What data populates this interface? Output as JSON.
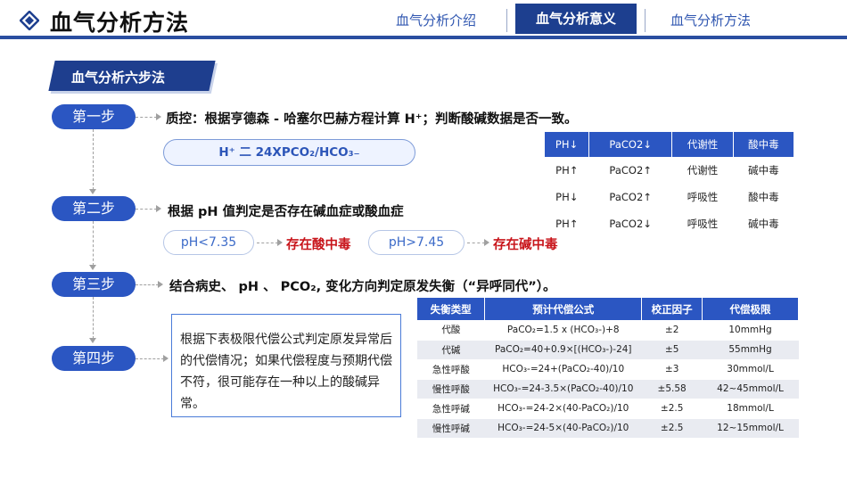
{
  "header": {
    "title": "血气分析方法",
    "nav": [
      "血气分析介绍",
      "血气分析意义",
      "血气分析方法"
    ],
    "active_nav": "血气分析意义"
  },
  "section": {
    "banner": "血气分析六步法"
  },
  "steps": [
    {
      "label": "第一步",
      "text": "质控：根据亨德森 - 哈塞尔巴赫方程计算 H⁺；判断酸碱数据是否一致。"
    },
    {
      "label": "第二步",
      "text": "根据 pH 值判定是否存在碱血症或酸血症"
    },
    {
      "label": "第三步",
      "text": "结合病史、 pH 、 PCO₂, 变化方向判定原发失衡（“异呼同代”）。"
    },
    {
      "label": "第四步",
      "text": ""
    }
  ],
  "formula": "H⁺ 二 24XPCO₂/HCO₃₋",
  "step2": {
    "ph_low": "pH<7.35",
    "ph_low_result": "存在酸中毒",
    "ph_high": "pH>7.45",
    "ph_high_result": "存在碱中毒"
  },
  "note": "根据下表极限代偿公式判定原发异常后的代偿情况；如果代偿程度与预期代偿不符，很可能存在一种以上的酸碱异常。",
  "table1": {
    "headers": [
      "PH↓",
      "PaCO2↓",
      "代谢性",
      "酸中毒"
    ],
    "rows": [
      [
        "PH↑",
        "PaCO2↑",
        "代谢性",
        "碱中毒"
      ],
      [
        "PH↓",
        "PaCO2↑",
        "呼吸性",
        "酸中毒"
      ],
      [
        "PH↑",
        "PaCO2↓",
        "呼吸性",
        "碱中毒"
      ]
    ]
  },
  "table2": {
    "headers": [
      "失衡类型",
      "预计代偿公式",
      "校正因子",
      "代偿极限"
    ],
    "rows": [
      [
        "代酸",
        "PaCO₂=1.5 x (HCO₃-)+8",
        "±2",
        "10mmHg"
      ],
      [
        "代碱",
        "PaCO₂=40+0.9×[(HCO₃-)-24]",
        "±5",
        "55mmHg"
      ],
      [
        "急性呼酸",
        "HCO₃-=24+(PaCO₂-40)/10",
        "±3",
        "30mmol/L"
      ],
      [
        "慢性呼酸",
        "HCO₃-=24-3.5×(PaCO₂-40)/10",
        "±5.58",
        "42~45mmol/L"
      ],
      [
        "急性呼碱",
        "HCO₃-=24-2×(40-PaCO₂)/10",
        "±2.5",
        "18mmol/L"
      ],
      [
        "慢性呼碱",
        "HCO₃-=24-5×(40-PaCO₂)/10",
        "±2.5",
        "12~15mmol/L"
      ]
    ]
  },
  "colors": {
    "primary": "#2b56c2",
    "dark": "#1d3f8f",
    "alert": "#c8151b"
  }
}
